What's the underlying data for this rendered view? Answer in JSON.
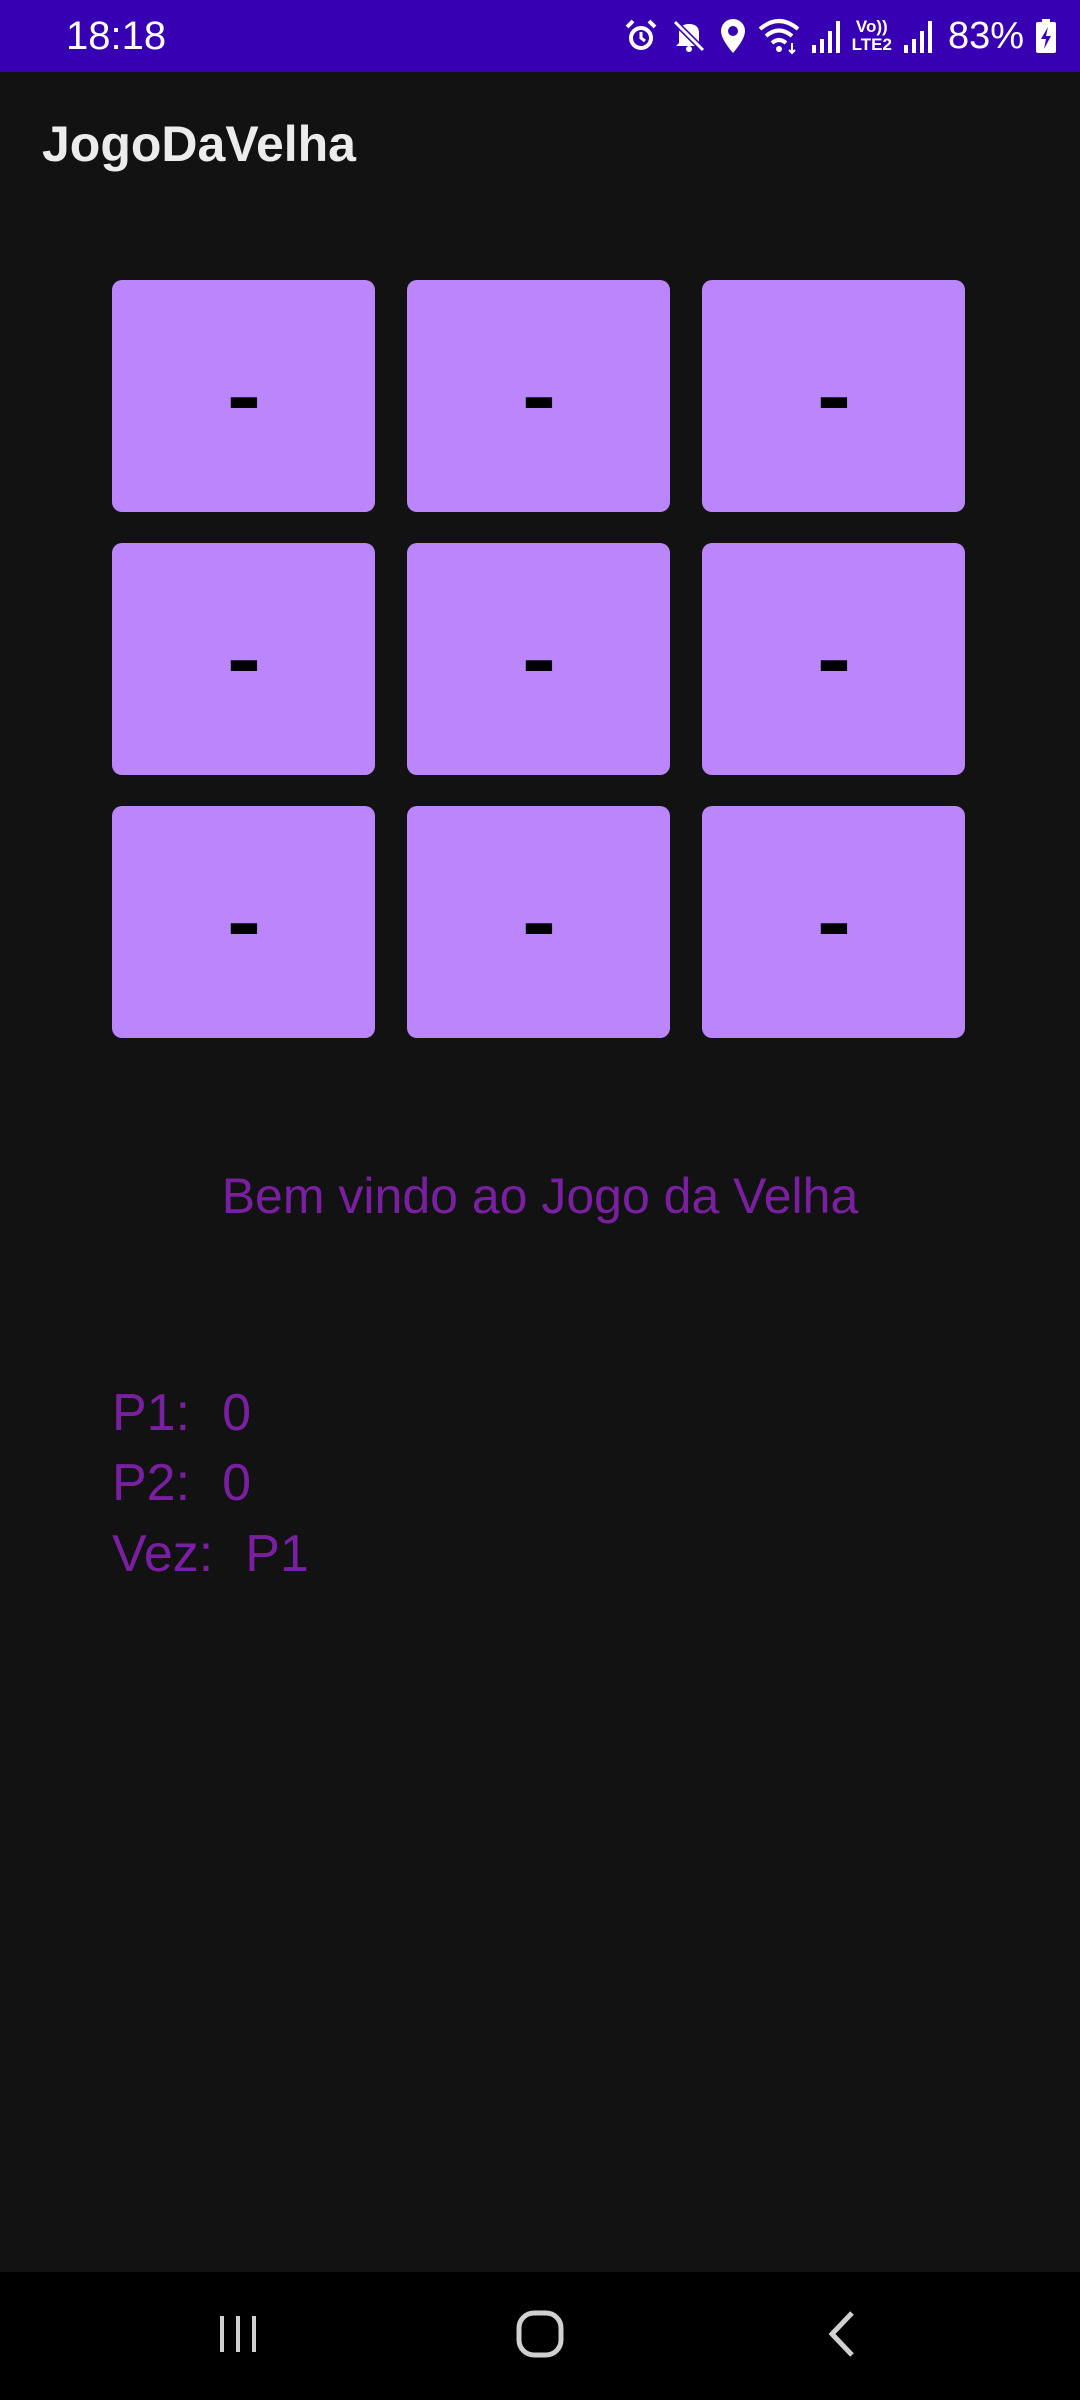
{
  "status_bar": {
    "time": "18:18",
    "icons": [
      "alarm-icon",
      "mute-icon",
      "location-icon",
      "wifi-icon",
      "signal-icon",
      "volte-icon",
      "signal-icon",
      "battery-charging-icon"
    ],
    "volte_label_top": "Vo))",
    "volte_label_bottom": "LTE2",
    "battery": "83%"
  },
  "app_bar": {
    "title": "JogoDaVelha"
  },
  "board": {
    "cells": [
      "-",
      "-",
      "-",
      "-",
      "-",
      "-",
      "-",
      "-",
      "-"
    ]
  },
  "message": "Bem vindo ao Jogo da Velha",
  "score": {
    "p1_label": "P1:",
    "p1_value": "0",
    "p2_label": "P2:",
    "p2_value": "0",
    "turn_label": "Vez:",
    "turn_value": "P1"
  },
  "nav_bar": {
    "icons": [
      "recents-icon",
      "home-icon",
      "back-icon"
    ]
  },
  "colors": {
    "status_bar": "#3700B3",
    "background": "#121212",
    "cell": "#BB86FC",
    "text_accent": "#7A1FA2",
    "nav_bar": "#000000"
  }
}
